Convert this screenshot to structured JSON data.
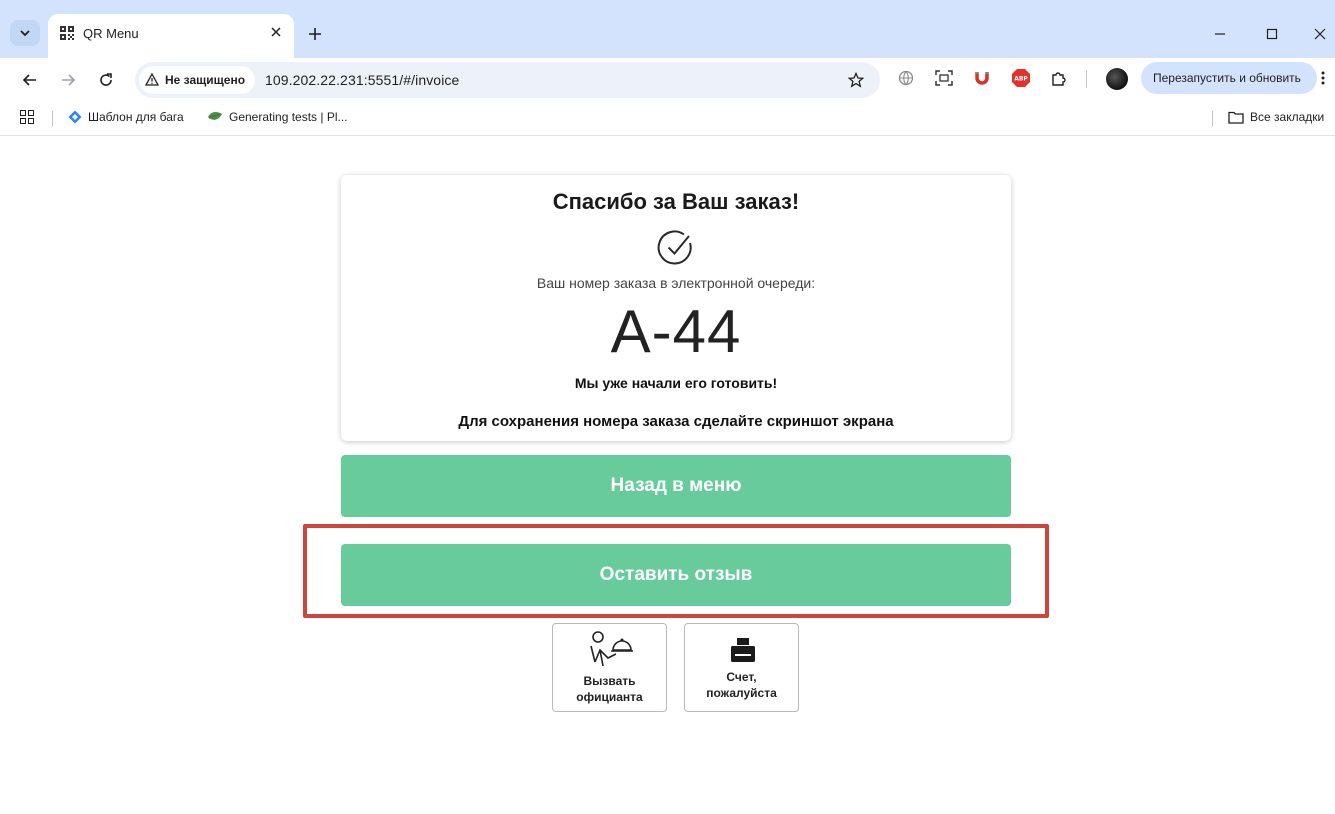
{
  "browser": {
    "tab_title": "QR Menu",
    "security_label": "Не защищено",
    "url": "109.202.22.231:5551/#/invoice",
    "update_button": "Перезапустить и обновить",
    "bookmarks": [
      {
        "label": "Шаблон для бага",
        "icon": "diamond-icon"
      },
      {
        "label": "Generating tests | Pl...",
        "icon": "leaf-icon"
      }
    ],
    "all_bookmarks": "Все закладки"
  },
  "page": {
    "title": "Спасибо за Ваш заказ!",
    "queue_label": "Ваш номер заказа в электронной очереди:",
    "order_number": "А-44",
    "cooking_text": "Мы уже начали его готовить!",
    "screenshot_hint": "Для сохранения номера заказа сделайте скриншот экрана",
    "back_to_menu": "Назад в меню",
    "leave_review": "Оставить отзыв",
    "call_waiter_line1": "Вызвать",
    "call_waiter_line2": "официанта",
    "bill_line1": "Счет,",
    "bill_line2": "пожалуйста"
  },
  "colors": {
    "accent_green": "#67cb9c",
    "highlight_red": "#d0453a",
    "tabstrip_bg": "#d3e3fd"
  }
}
